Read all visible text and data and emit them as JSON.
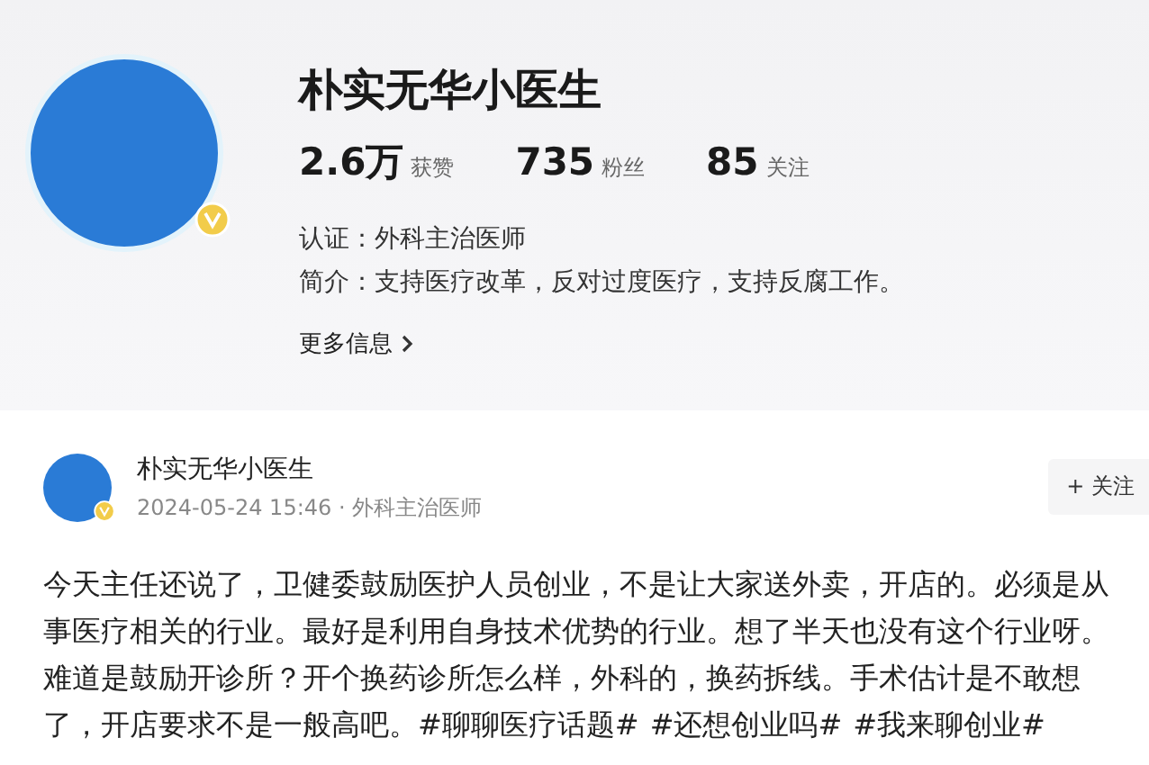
{
  "profile": {
    "name": "朴实无华小医生",
    "verified": true,
    "stats": [
      {
        "value": "2.6万",
        "label": "获赞"
      },
      {
        "value": "735",
        "label": "粉丝"
      },
      {
        "value": "85",
        "label": "关注"
      }
    ],
    "certification": "认证：外科主治医师",
    "intro": "简介：支持医疗改革，反对过度医疗，支持反腐工作。",
    "more_info": "更多信息"
  },
  "post": {
    "author": "朴实无华小医生",
    "verified": true,
    "meta": "2024-05-24 15:46 · 外科主治医师",
    "follow_button": "+ 关注",
    "body": "今天主任还说了，卫健委鼓励医护人员创业，不是让大家送外卖，开店的。必须是从事医疗相关的行业。最好是利用自身技术优势的行业。想了半天也没有这个行业呀。难道是鼓励开诊所？开个换药诊所怎么样，外科的，换药拆线。手术估计是不敢想了，开店要求不是一般高吧。",
    "hashtags": [
      "#聊聊医疗话题#",
      "#还想创业吗#",
      "#我来聊创业#"
    ]
  }
}
